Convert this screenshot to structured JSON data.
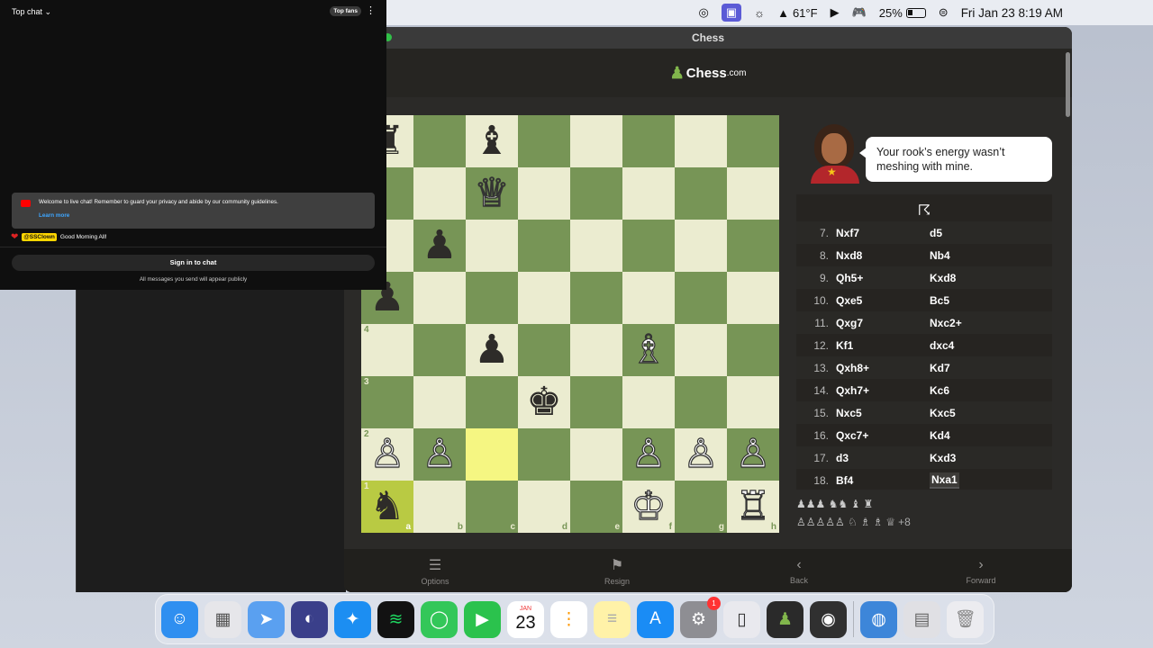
{
  "menubar": {
    "temperature": "61°F",
    "battery": "25%",
    "clock": "Fri Jan 23  8:19 AM"
  },
  "chess_window": {
    "title": "Chess",
    "logo": "Chess",
    "logo_suffix": ".com",
    "coach_message": "Your rook’s energy wasn’t meshing with mine.",
    "board": {
      "light_color": "#ebecd0",
      "dark_color": "#779556",
      "highlight_color": "#f5f682",
      "ranks": [
        "8",
        "7",
        "6",
        "5",
        "4",
        "3",
        "2",
        "1"
      ],
      "files": [
        "a",
        "b",
        "c",
        "d",
        "e",
        "f",
        "g",
        "h"
      ],
      "rows": [
        [
          "bR",
          "",
          "bB",
          "",
          "",
          "",
          "",
          ""
        ],
        [
          "",
          "",
          "wQ",
          "",
          "",
          "",
          "",
          ""
        ],
        [
          "",
          "bP",
          "",
          "",
          "",
          "",
          "",
          ""
        ],
        [
          "bP",
          "",
          "",
          "",
          "",
          "",
          "",
          ""
        ],
        [
          "",
          "",
          "bP",
          "",
          "",
          "wB",
          "",
          ""
        ],
        [
          "",
          "",
          "",
          "bK",
          "",
          "",
          "",
          ""
        ],
        [
          "wP",
          "wP",
          "",
          "",
          "",
          "wP",
          "wP",
          "wP"
        ],
        [
          "bN",
          "",
          "",
          "",
          "",
          "wK",
          "",
          "wR"
        ]
      ]
    },
    "moves": [
      {
        "n": "7.",
        "w": "Nxf7",
        "b": "d5"
      },
      {
        "n": "8.",
        "w": "Nxd8",
        "b": "Nb4"
      },
      {
        "n": "9.",
        "w": "Qh5+",
        "b": "Kxd8"
      },
      {
        "n": "10.",
        "w": "Qxe5",
        "b": "Bc5"
      },
      {
        "n": "11.",
        "w": "Qxg7",
        "b": "Nxc2+"
      },
      {
        "n": "12.",
        "w": "Kf1",
        "b": "dxc4"
      },
      {
        "n": "13.",
        "w": "Qxh8+",
        "b": "Kd7"
      },
      {
        "n": "14.",
        "w": "Qxh7+",
        "b": "Kc6"
      },
      {
        "n": "15.",
        "w": "Nxc5",
        "b": "Kxc5"
      },
      {
        "n": "16.",
        "w": "Qxc7+",
        "b": "Kd4"
      },
      {
        "n": "17.",
        "w": "d3",
        "b": "Kxd3"
      },
      {
        "n": "18.",
        "w": "Bf4",
        "b": "Nxa1"
      }
    ],
    "captured_white": "♟♟♟ ♞♞ ♝ ♜",
    "captured_black": "♙♙♙♙♙ ♘ ♗ ♗ ♕",
    "material_diff": "+8",
    "controls": {
      "options": "Options",
      "resign": "Resign",
      "back": "Back",
      "forward": "Forward"
    }
  },
  "chat": {
    "header": "Top chat",
    "top_fans": "Top fans",
    "welcome": "Welcome to live chat! Remember to guard your privacy and abide by our community guidelines.",
    "learn_more": "Learn more",
    "message_user": "@SSClown",
    "message_text": "Good Morning All!",
    "sign_in": "Sign in to chat",
    "note": "All messages you send will appear publicly"
  },
  "dock": {
    "calendar_month": "JAN",
    "calendar_day": "23",
    "settings_badge": "1"
  }
}
